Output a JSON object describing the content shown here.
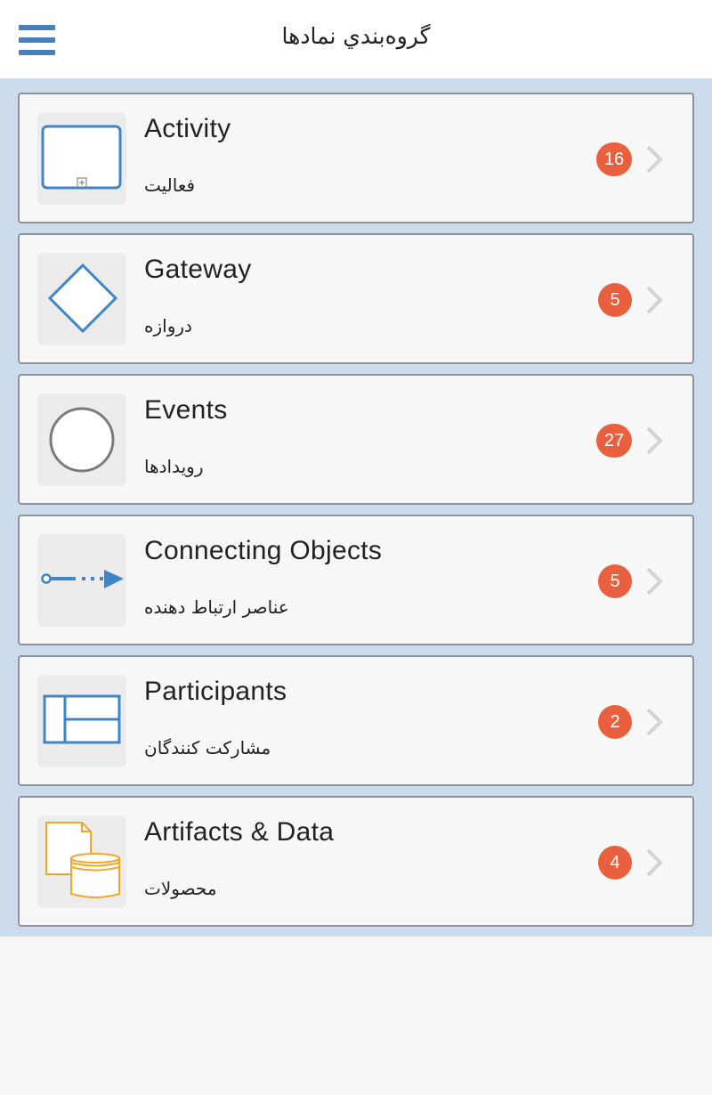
{
  "header": {
    "title": "گروه‌بندي نمادها",
    "menu_icon": "hamburger-menu-icon"
  },
  "colors": {
    "accent": "#4a7fbd",
    "badge": "#e9603f",
    "list_background": "#cddced",
    "artifact": "#f5a623"
  },
  "categories": [
    {
      "title": "Activity",
      "subtitle": "فعاليت",
      "count": "16",
      "icon": "activity-task-icon"
    },
    {
      "title": "Gateway",
      "subtitle": "دروازه",
      "count": "5",
      "icon": "gateway-diamond-icon"
    },
    {
      "title": "Events",
      "subtitle": "رويدادها",
      "count": "27",
      "icon": "event-circle-icon"
    },
    {
      "title": "Connecting Objects",
      "subtitle": "عناصر ارتباط دهنده",
      "count": "5",
      "icon": "connector-arrow-icon"
    },
    {
      "title": "Participants",
      "subtitle": "مشارکت کنندگان",
      "count": "2",
      "icon": "pool-lanes-icon"
    },
    {
      "title": "Artifacts & Data",
      "subtitle": "محصولات",
      "count": "4",
      "icon": "data-object-store-icon"
    }
  ]
}
